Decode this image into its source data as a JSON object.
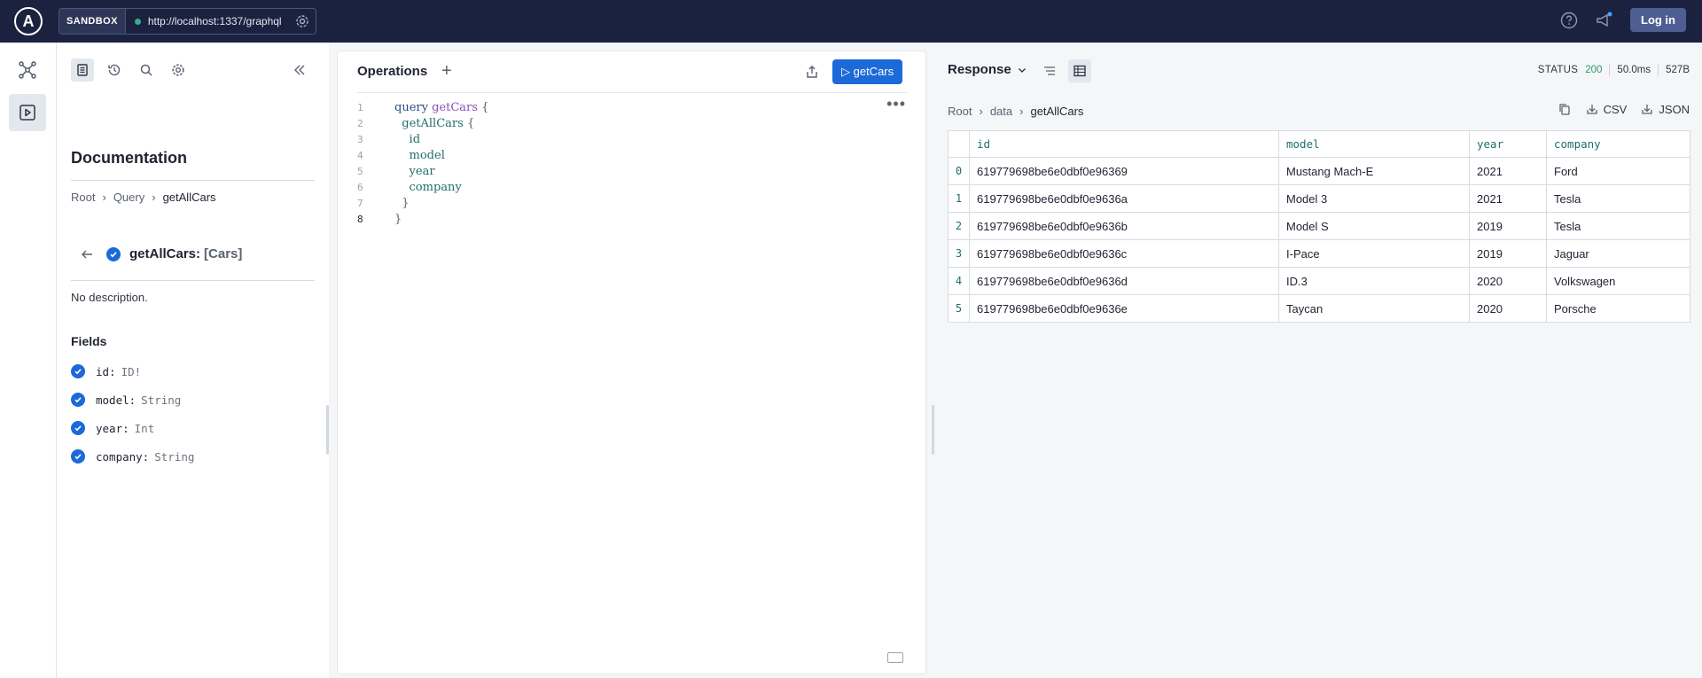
{
  "topbar": {
    "logo_letter": "A",
    "sandbox_label": "SANDBOX",
    "endpoint_url": "http://localhost:1337/graphql",
    "login_label": "Log in"
  },
  "docs": {
    "title": "Documentation",
    "breadcrumb": [
      "Root",
      "Query",
      "getAllCars"
    ],
    "field_name": "getAllCars:",
    "field_type": "[Cars]",
    "description": "No description.",
    "fields_title": "Fields",
    "fields": [
      {
        "name": "id:",
        "type": "ID!"
      },
      {
        "name": "model:",
        "type": "String"
      },
      {
        "name": "year:",
        "type": "Int"
      },
      {
        "name": "company:",
        "type": "String"
      }
    ]
  },
  "operations": {
    "title": "Operations",
    "plus": "+",
    "run_label": "▷ getCars",
    "more": "•••",
    "lines": [
      "1",
      "2",
      "3",
      "4",
      "5",
      "6",
      "7",
      "8"
    ],
    "code": {
      "keyword": "query",
      "op_name": "getCars",
      "open_brace": "{",
      "root_field": "getAllCars",
      "fields": [
        "id",
        "model",
        "year",
        "company"
      ],
      "close_brace": "}"
    }
  },
  "response": {
    "title": "Response",
    "status_label": "STATUS",
    "status_code": "200",
    "time": "50.0ms",
    "size": "527B",
    "breadcrumb": [
      "Root",
      "data",
      "getAllCars"
    ],
    "csv_label": "CSV",
    "json_label": "JSON",
    "columns": [
      "id",
      "model",
      "year",
      "company"
    ],
    "rows": [
      {
        "index": "0",
        "id": "619779698be6e0dbf0e96369",
        "model": "Mustang Mach-E",
        "year": "2021",
        "company": "Ford"
      },
      {
        "index": "1",
        "id": "619779698be6e0dbf0e9636a",
        "model": "Model 3",
        "year": "2021",
        "company": "Tesla"
      },
      {
        "index": "2",
        "id": "619779698be6e0dbf0e9636b",
        "model": "Model S",
        "year": "2019",
        "company": "Tesla"
      },
      {
        "index": "3",
        "id": "619779698be6e0dbf0e9636c",
        "model": "I-Pace",
        "year": "2019",
        "company": "Jaguar"
      },
      {
        "index": "4",
        "id": "619779698be6e0dbf0e9636d",
        "model": "ID.3",
        "year": "2020",
        "company": "Volkswagen"
      },
      {
        "index": "5",
        "id": "619779698be6e0dbf0e9636e",
        "model": "Taycan",
        "year": "2020",
        "company": "Porsche"
      }
    ]
  },
  "colors": {
    "topbar": "#1b2240",
    "primary": "#1c6ad8",
    "status_ok": "#2d9a6a"
  },
  "icons": {
    "rail": [
      "schema-graph-icon",
      "explorer-play-icon"
    ],
    "doc_toolbar": [
      "documentation-icon",
      "history-icon",
      "search-icon",
      "settings-gear-icon"
    ],
    "topbar": [
      "help-circle-icon",
      "announcement-megaphone-icon"
    ]
  }
}
